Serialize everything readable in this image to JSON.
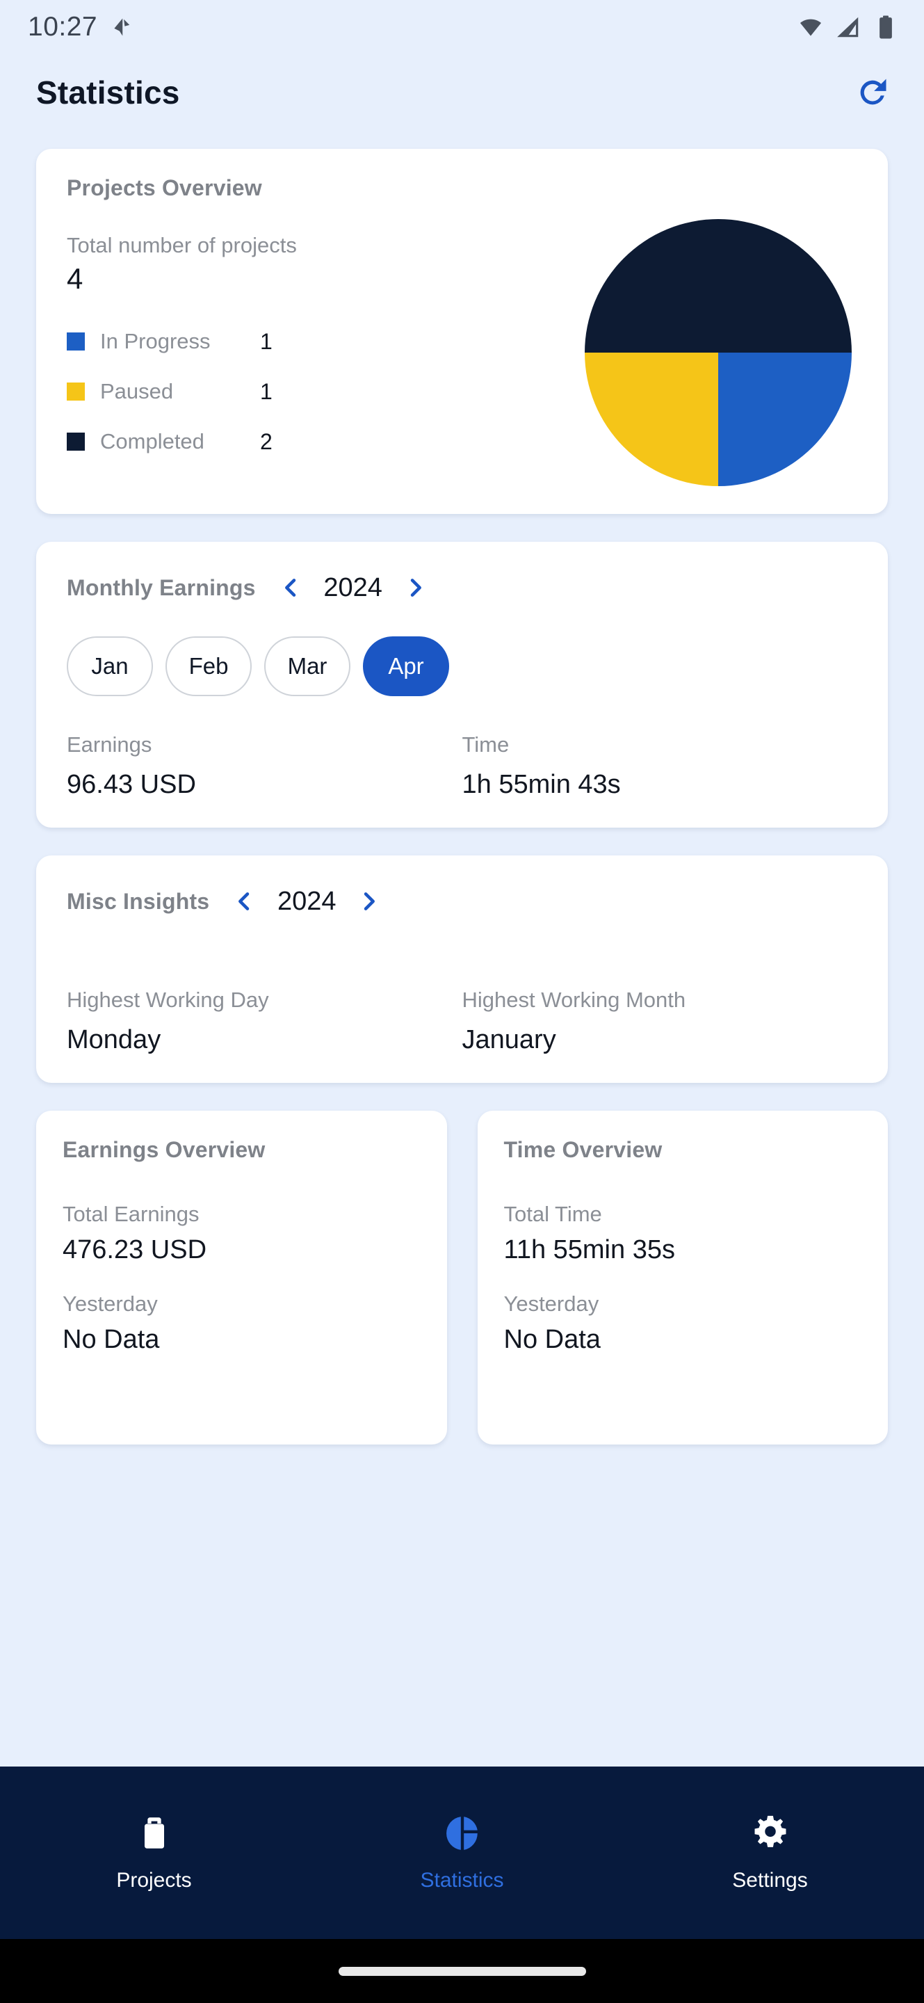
{
  "status_bar": {
    "time": "10:27",
    "left_icon": "arrow-location-icon",
    "icons": [
      "wifi-icon",
      "cellular-signal-icon",
      "battery-icon"
    ]
  },
  "header": {
    "title": "Statistics",
    "refresh_icon": "refresh-icon"
  },
  "colors": {
    "background": "#e7effc",
    "card": "#ffffff",
    "accent_blue": "#1b56c4",
    "in_progress": "#1d5fc4",
    "paused": "#f5c518",
    "completed": "#0d1b33",
    "nav_bar": "#071a3d",
    "nav_active": "#2f6fe0",
    "muted_text": "#8b8f96"
  },
  "projects_overview": {
    "title": "Projects Overview",
    "total_label": "Total number of projects",
    "total_value": "4",
    "legend": [
      {
        "label": "In Progress",
        "value": "1",
        "color": "#1d5fc4"
      },
      {
        "label": "Paused",
        "value": "1",
        "color": "#f5c518"
      },
      {
        "label": "Completed",
        "value": "2",
        "color": "#0d1b33"
      }
    ]
  },
  "chart_data": {
    "type": "pie",
    "title": "Projects Overview",
    "categories": [
      "Completed",
      "In Progress",
      "Paused"
    ],
    "values": [
      2,
      1,
      1
    ],
    "percentages": [
      50,
      25,
      25
    ],
    "colors": [
      "#0d1b33",
      "#1d5fc4",
      "#f5c518"
    ],
    "total": 4,
    "legend_position": "left",
    "labels_shown": false
  },
  "monthly_earnings": {
    "title": "Monthly Earnings",
    "year": "2024",
    "prev_icon": "chevron-left-icon",
    "next_icon": "chevron-right-icon",
    "months": [
      {
        "label": "Jan",
        "selected": false
      },
      {
        "label": "Feb",
        "selected": false
      },
      {
        "label": "Mar",
        "selected": false
      },
      {
        "label": "Apr",
        "selected": true
      }
    ],
    "earnings_label": "Earnings",
    "earnings_value": "96.43 USD",
    "time_label": "Time",
    "time_value": "1h 55min 43s"
  },
  "misc_insights": {
    "title": "Misc Insights",
    "year": "2024",
    "prev_icon": "chevron-left-icon",
    "next_icon": "chevron-right-icon",
    "day_label": "Highest Working Day",
    "day_value": "Monday",
    "month_label": "Highest Working Month",
    "month_value": "January"
  },
  "earnings_overview": {
    "title": "Earnings Overview",
    "total_label": "Total Earnings",
    "total_value": "476.23 USD",
    "yesterday_label": "Yesterday",
    "yesterday_value": "No Data"
  },
  "time_overview": {
    "title": "Time Overview",
    "total_label": "Total Time",
    "total_value": "11h 55min 35s",
    "yesterday_label": "Yesterday",
    "yesterday_value": "No Data"
  },
  "bottom_nav": {
    "items": [
      {
        "label": "Projects",
        "icon": "briefcase-icon",
        "active": false
      },
      {
        "label": "Statistics",
        "icon": "pie-chart-icon",
        "active": true
      },
      {
        "label": "Settings",
        "icon": "gear-icon",
        "active": false
      }
    ]
  }
}
